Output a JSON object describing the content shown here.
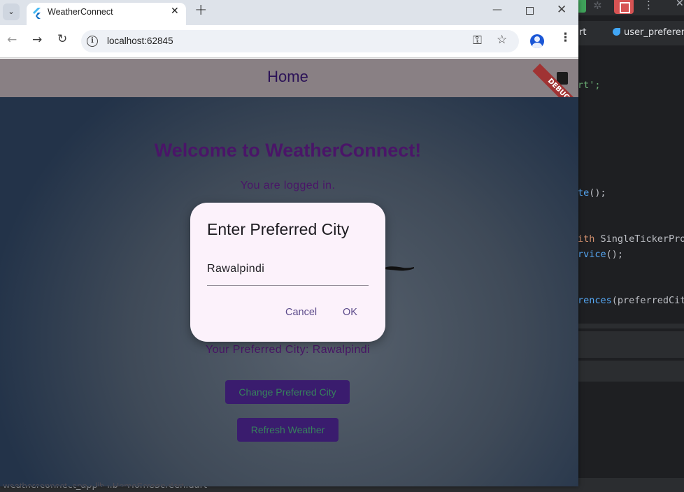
{
  "browser": {
    "tab_title": "WeatherConnect",
    "url": "localhost:62845"
  },
  "app": {
    "appbar_title": "Home",
    "debug_label": "DEBUG",
    "welcome": "Welcome to WeatherConnect!",
    "logged_in": "You are logged in.",
    "preferred_city_text": "Your Preferred City: Rawalpindi",
    "change_city_button": "Change Preferred City",
    "refresh_button": "Refresh Weather",
    "colors": {
      "appbar": "#898084",
      "text": "#4a1568",
      "button_bg": "#3a1c6e",
      "button_text": "#37825c"
    }
  },
  "dialog": {
    "title": "Enter Preferred City",
    "input_value": "Rawalpindi",
    "cancel": "Cancel",
    "ok": "OK"
  },
  "ide": {
    "tab1": "rt",
    "tab2": "user_preferen",
    "status_path": "weatherconnect_app  ›  lib  ›  HomeScreen.dart",
    "code": {
      "l1": "rt';",
      "l2a": "te",
      "l2b": "();",
      "l3a": "ith ",
      "l3b": "SingleTickerProv",
      "l4a": "rvice",
      "l4b": "();",
      "l5a": "rences",
      "l5b": "(preferredCity"
    }
  }
}
